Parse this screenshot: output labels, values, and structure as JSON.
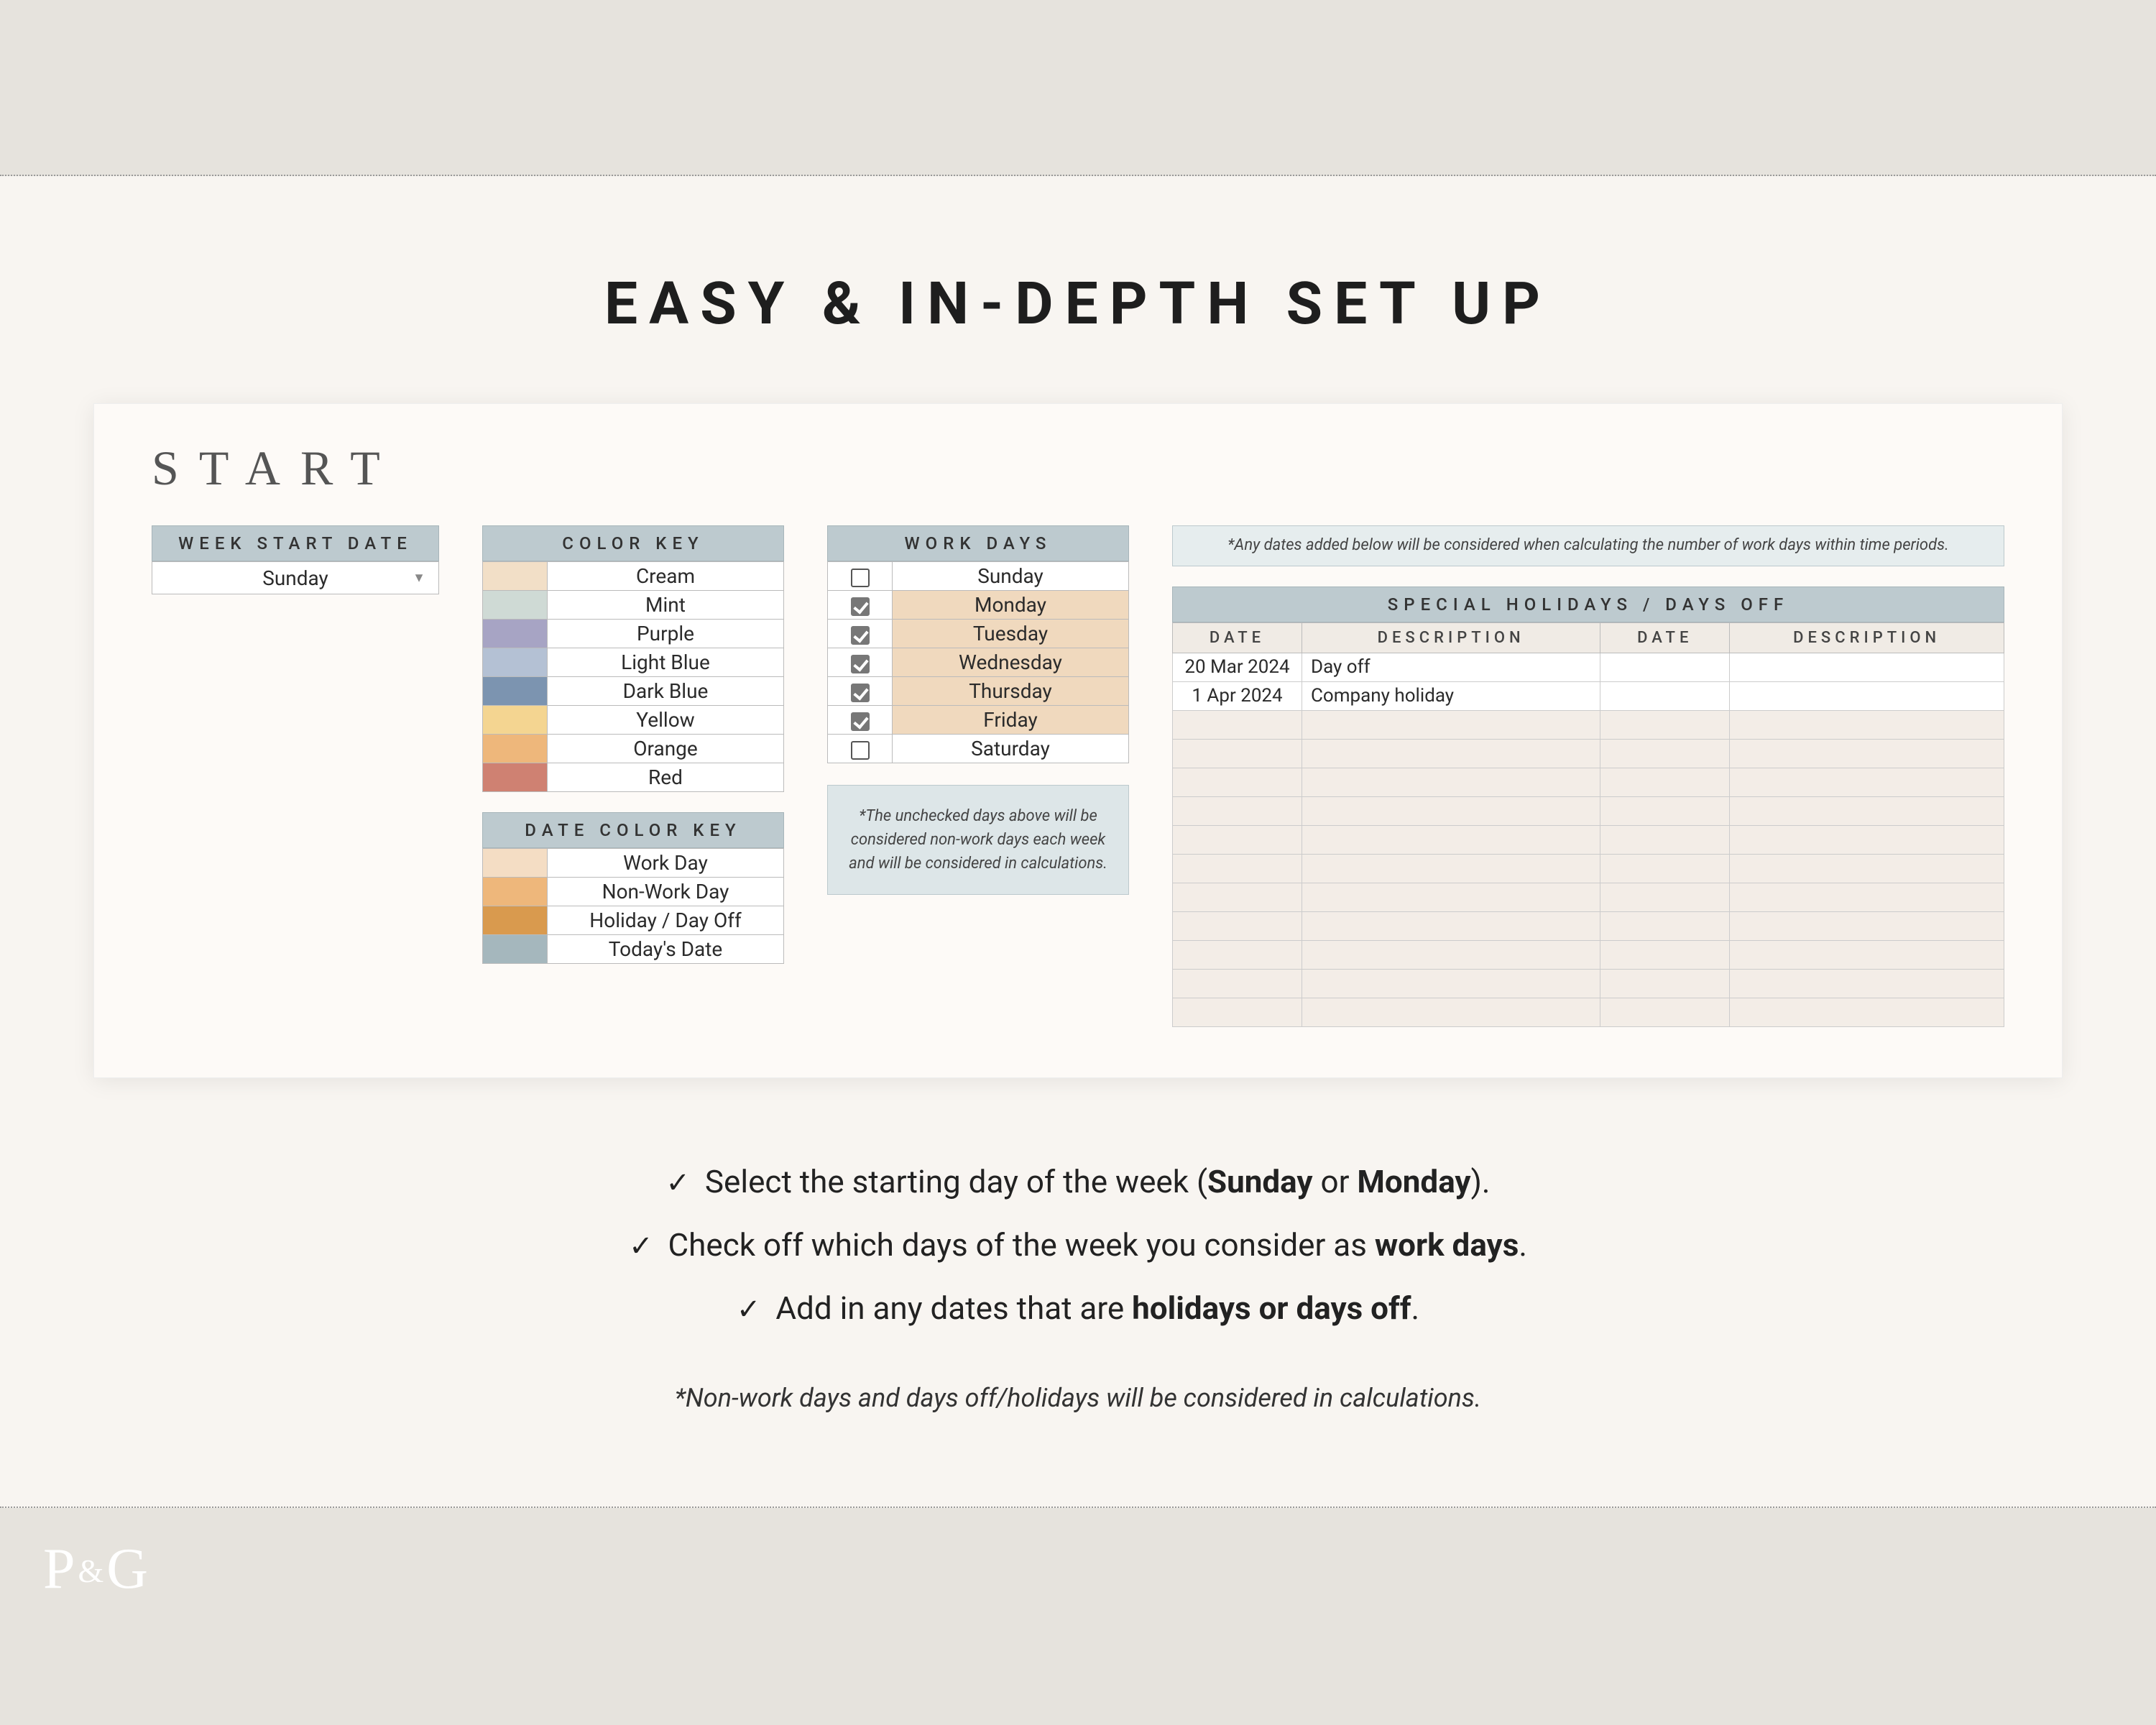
{
  "title": "EASY & IN-DEPTH SET UP",
  "start_heading": "START",
  "week_start": {
    "header": "WEEK START DATE",
    "value": "Sunday"
  },
  "color_key": {
    "header": "COLOR KEY",
    "items": [
      {
        "label": "Cream",
        "swatch": "c-cream"
      },
      {
        "label": "Mint",
        "swatch": "c-mint"
      },
      {
        "label": "Purple",
        "swatch": "c-purple"
      },
      {
        "label": "Light Blue",
        "swatch": "c-lblue"
      },
      {
        "label": "Dark Blue",
        "swatch": "c-dblue"
      },
      {
        "label": "Yellow",
        "swatch": "c-yellow"
      },
      {
        "label": "Orange",
        "swatch": "c-orange"
      },
      {
        "label": "Red",
        "swatch": "c-red"
      }
    ]
  },
  "date_color_key": {
    "header": "DATE COLOR KEY",
    "items": [
      {
        "label": "Work Day",
        "swatch": "c-work"
      },
      {
        "label": "Non-Work Day",
        "swatch": "c-nonwork"
      },
      {
        "label": "Holiday / Day Off",
        "swatch": "c-holiday"
      },
      {
        "label": "Today's Date",
        "swatch": "c-today"
      }
    ]
  },
  "work_days": {
    "header": "WORK DAYS",
    "days": [
      {
        "label": "Sunday",
        "checked": false
      },
      {
        "label": "Monday",
        "checked": true
      },
      {
        "label": "Tuesday",
        "checked": true
      },
      {
        "label": "Wednesday",
        "checked": true
      },
      {
        "label": "Thursday",
        "checked": true
      },
      {
        "label": "Friday",
        "checked": true
      },
      {
        "label": "Saturday",
        "checked": false
      }
    ],
    "note": "*The unchecked days above will be considered non-work days each week and will be considered in calculations."
  },
  "holidays": {
    "top_note": "*Any dates added below will be considered when calculating the number of work days within time periods.",
    "header": "SPECIAL HOLIDAYS / DAYS OFF",
    "col_date": "DATE",
    "col_desc": "DESCRIPTION",
    "rows": [
      {
        "date": "20 Mar 2024",
        "desc": "Day off"
      },
      {
        "date": "1 Apr 2024",
        "desc": "Company holiday"
      }
    ],
    "empty_rows": 11
  },
  "bullets": {
    "b1_pre": "Select the starting day of the week (",
    "b1_bold1": "Sunday",
    "b1_mid": " or ",
    "b1_bold2": "Monday",
    "b1_post": ").",
    "b2_pre": "Check off which days of the week you consider as ",
    "b2_bold": "work days",
    "b2_post": ".",
    "b3_pre": "Add in any dates that are ",
    "b3_bold": "holidays or days off",
    "b3_post": "."
  },
  "footnote": "*Non-work days and days off/holidays will be considered in calculations.",
  "logo": {
    "p": "P",
    "amp": "&",
    "g": "G"
  }
}
